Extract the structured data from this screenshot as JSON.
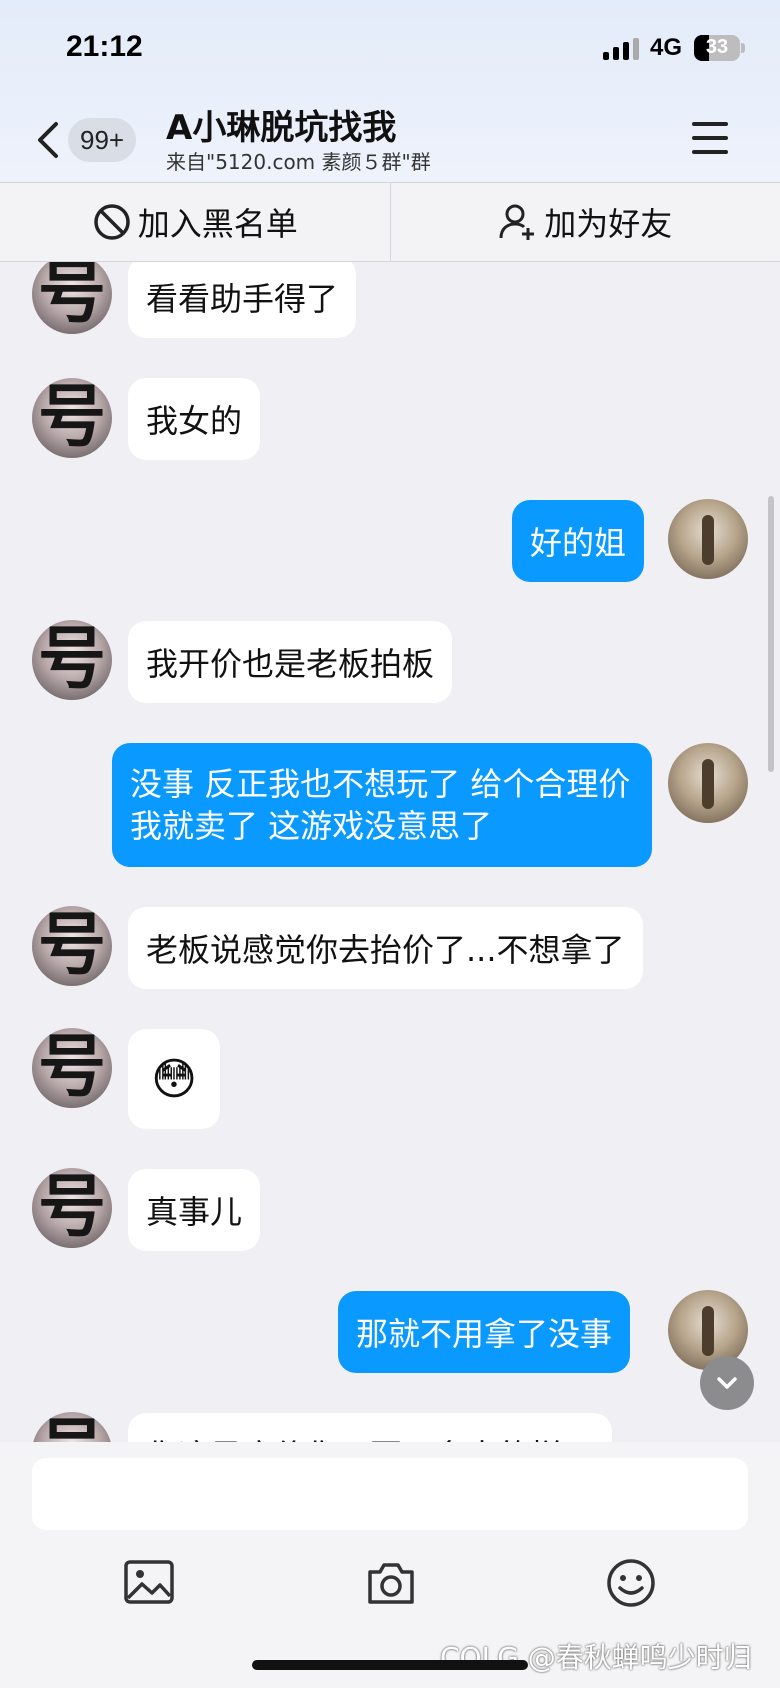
{
  "status": {
    "time": "21:12",
    "network": "4G",
    "battery": "33",
    "battery_level": 0.33
  },
  "header": {
    "unread_count": "99+",
    "title": "A小琳脱坑找我",
    "subtitle": "来自\"5120.com 素颜５群\"群"
  },
  "actions": {
    "block": "加入黑名单",
    "add_friend": "加为好友"
  },
  "messages": [
    {
      "from": "them",
      "text": "看看助手得了"
    },
    {
      "from": "them",
      "text": "我女的"
    },
    {
      "from": "me",
      "text": "好的姐"
    },
    {
      "from": "them",
      "text": "我开价也是老板拍板"
    },
    {
      "from": "me",
      "text": "没事 反正我也不想玩了 给个合理价我就卖了 这游戏没意思了"
    },
    {
      "from": "them",
      "text": "老板说感觉你去抬价了...不想拿了"
    },
    {
      "from": "them",
      "text": "😳"
    },
    {
      "from": "them",
      "text": "真事儿"
    },
    {
      "from": "me",
      "text": "那就不用拿了没事"
    },
    {
      "from": "them",
      "text": "你这是底价你…要…多大的样子"
    }
  ],
  "avatar_glyph": "号",
  "icons": {
    "back": "chevron-left-icon",
    "menu": "hamburger-icon",
    "block": "ban-icon",
    "add_friend": "user-plus-icon",
    "scroll_down": "chevron-down-icon",
    "image": "image-icon",
    "camera": "camera-icon",
    "emoji": "smiley-icon"
  },
  "colors": {
    "my_bubble": "#0a99ff",
    "their_bubble": "#ffffff",
    "background": "#efeff4"
  },
  "watermark": "COLG @春秋蝉鸣少时归"
}
